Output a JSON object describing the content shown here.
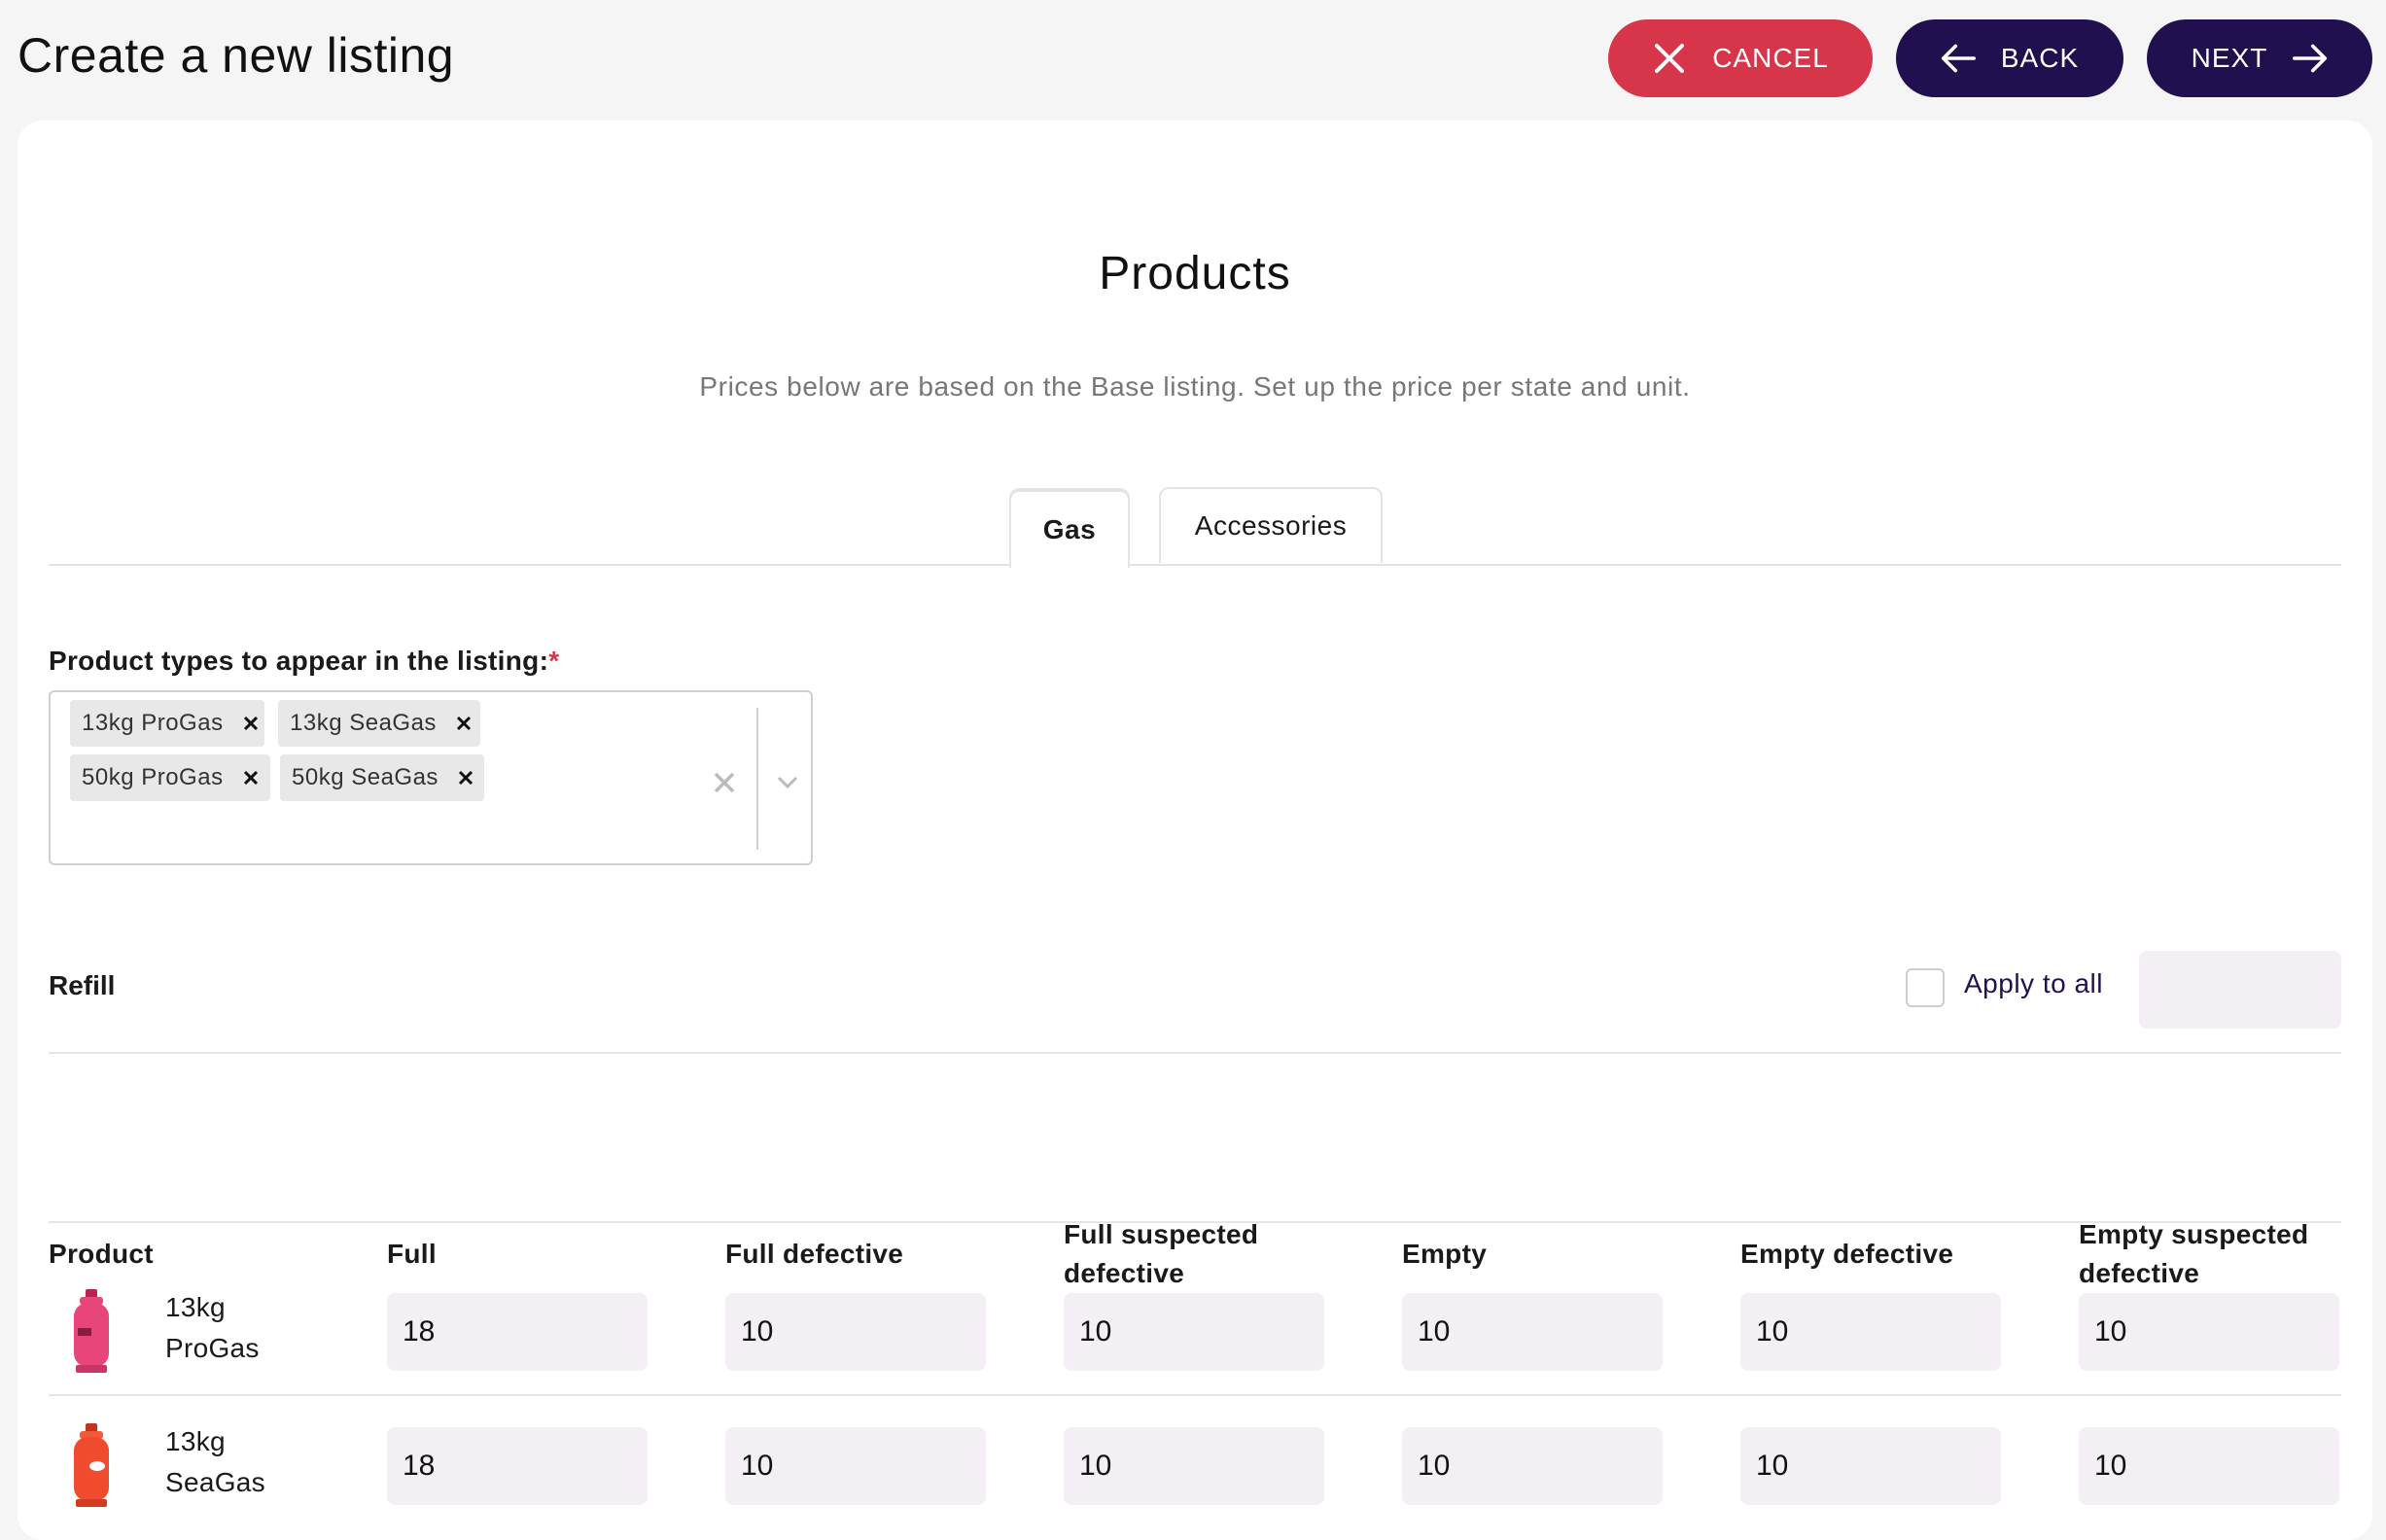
{
  "header": {
    "title": "Create a new listing",
    "cancel_label": "CANCEL",
    "back_label": "BACK",
    "next_label": "NEXT"
  },
  "colors": {
    "cancel": "#d7364a",
    "primary": "#20104f",
    "input_bg": "#f3eff5"
  },
  "section": {
    "title": "Products",
    "subtitle": "Prices below are based on the Base listing. Set up the price per state and unit."
  },
  "tabs": [
    {
      "label": "Gas",
      "active": true
    },
    {
      "label": "Accessories",
      "active": false
    }
  ],
  "product_types": {
    "label": "Product types to appear in the listing:",
    "required_mark": "*",
    "selected": [
      "13kg ProGas",
      "13kg SeaGas",
      "50kg ProGas",
      "50kg SeaGas"
    ]
  },
  "refill": {
    "label": "Refill",
    "apply_to_all_label": "Apply to all",
    "apply_to_all_checked": false,
    "apply_to_all_value": ""
  },
  "table": {
    "columns": [
      "Product",
      "Full",
      "Full defective",
      "Full suspected defective",
      "Empty",
      "Empty defective",
      "Empty suspected defective"
    ],
    "rows": [
      {
        "product_line1": "13kg",
        "product_line2": "ProGas",
        "icon": "pink-gas-cylinder-icon",
        "values": [
          "18",
          "10",
          "10",
          "10",
          "10",
          "10"
        ]
      },
      {
        "product_line1": "13kg",
        "product_line2": "SeaGas",
        "icon": "orange-gas-cylinder-icon",
        "values": [
          "18",
          "10",
          "10",
          "10",
          "10",
          "10"
        ]
      }
    ]
  }
}
